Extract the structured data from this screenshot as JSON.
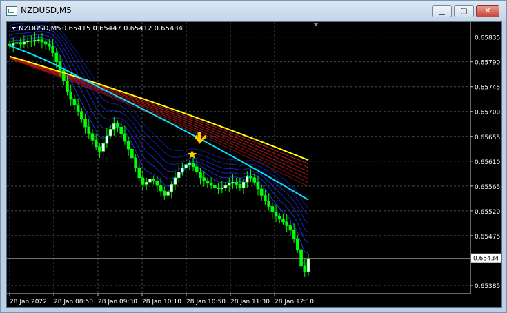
{
  "window": {
    "title": "NZDUSD,M5",
    "icon": "chart-window-icon",
    "min_glyph": "▁",
    "max_glyph": "▢",
    "close_glyph": "✕"
  },
  "header": {
    "symbol": "NZDUSD,M5",
    "ohlc": "0.65415 0.65447 0.65412 0.65434"
  },
  "colors": {
    "background": "#000000",
    "grid": "#4a4a4a",
    "bull": "#ffffff",
    "bear": "#00ff00",
    "fast_ma": "#00e5ff",
    "slow_ma": "#ffff00",
    "blue_ribbon": "#1838ff",
    "red_ribbon": "#c81818"
  },
  "chart_data": {
    "type": "candlestick",
    "y_range": [
      0.6537,
      0.65862
    ],
    "price_ticks": [
      0.65835,
      0.6579,
      0.65745,
      0.657,
      0.65655,
      0.6561,
      0.65565,
      0.6552,
      0.65475,
      0.65385
    ],
    "tick_labels": [
      "0.65835",
      "0.65790",
      "0.65745",
      "0.65700",
      "0.65655",
      "0.65610",
      "0.65565",
      "0.65520",
      "0.65475",
      "0.65385"
    ],
    "current_price": 0.65434,
    "current_price_label": "0.65434",
    "time_labels": [
      "28 Jan 2022",
      "28 Jan 08:50",
      "28 Jan 09:30",
      "28 Jan 10:10",
      "28 Jan 10:50",
      "28 Jan 11:30",
      "28 Jan 12:10"
    ],
    "close_path": [
      0.6582,
      0.65823,
      0.65825,
      0.65822,
      0.65826,
      0.65828,
      0.65827,
      0.65829,
      0.6583,
      0.65826,
      0.65822,
      0.65818,
      0.65806,
      0.6579,
      0.65774,
      0.65755,
      0.65735,
      0.65722,
      0.65712,
      0.657,
      0.65686,
      0.65672,
      0.6566,
      0.65648,
      0.65636,
      0.65628,
      0.65642,
      0.65656,
      0.65668,
      0.65678,
      0.65672,
      0.6566,
      0.65646,
      0.65632,
      0.65616,
      0.65598,
      0.6558,
      0.65568,
      0.65572,
      0.65578,
      0.65574,
      0.65566,
      0.65556,
      0.65548,
      0.65555,
      0.65568,
      0.6558,
      0.6559,
      0.65598,
      0.65604,
      0.65606,
      0.656,
      0.6559,
      0.6558,
      0.65574,
      0.6557,
      0.65566,
      0.65562,
      0.6556,
      0.65562,
      0.65566,
      0.6557,
      0.65572,
      0.65568,
      0.65562,
      0.65572,
      0.65582,
      0.6558,
      0.65572,
      0.6556,
      0.65548,
      0.65538,
      0.65528,
      0.65518,
      0.6551,
      0.65505,
      0.655,
      0.65493,
      0.65485,
      0.6547,
      0.6545,
      0.6542,
      0.6541,
      0.65434
    ],
    "indicators": {
      "fast_ma": {
        "color": "#00e5ff",
        "start": 0.65818,
        "mid": 0.657,
        "end": 0.6554
      },
      "slow_ma": {
        "color": "#ffff00",
        "start": 0.658,
        "mid": 0.6572,
        "end": 0.65612
      },
      "blue_ribbon_count": 7,
      "red_ribbon_count": 8
    },
    "markers": [
      {
        "type": "arrow-down",
        "color": "#ffcc00"
      },
      {
        "type": "star",
        "color": "#ffcc00"
      }
    ]
  }
}
